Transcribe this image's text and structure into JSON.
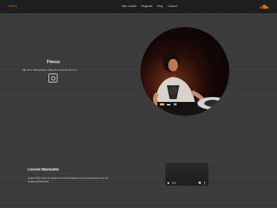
{
  "header": {
    "brand": "Flexus",
    "nav": [
      {
        "label": "Mijn muziek"
      },
      {
        "label": "Biografie"
      },
      {
        "label": "Blog"
      },
      {
        "label": "Contact"
      }
    ],
    "right_icon": "soundcloud-icon"
  },
  "hero": {
    "title": "Flexus",
    "subtitle": "Mijn uit de hand gelopen hobby als 16-un-old Drive DJ",
    "icon": "instagram-icon"
  },
  "liveset": {
    "title": "Liveset Maxiradio",
    "text": "In april 2023 mocht ik namens het event Rotondum voor 8 resident fans een set draaien bij Maxiradio."
  },
  "video": {
    "time": "0:00",
    "play_icon": "play-icon",
    "volume_icon": "volume-icon",
    "more_icon": "more-icon"
  },
  "colors": {
    "brand": "#e36c1a",
    "topbar": "#1e1e1e",
    "background": "#3a3a3a"
  }
}
